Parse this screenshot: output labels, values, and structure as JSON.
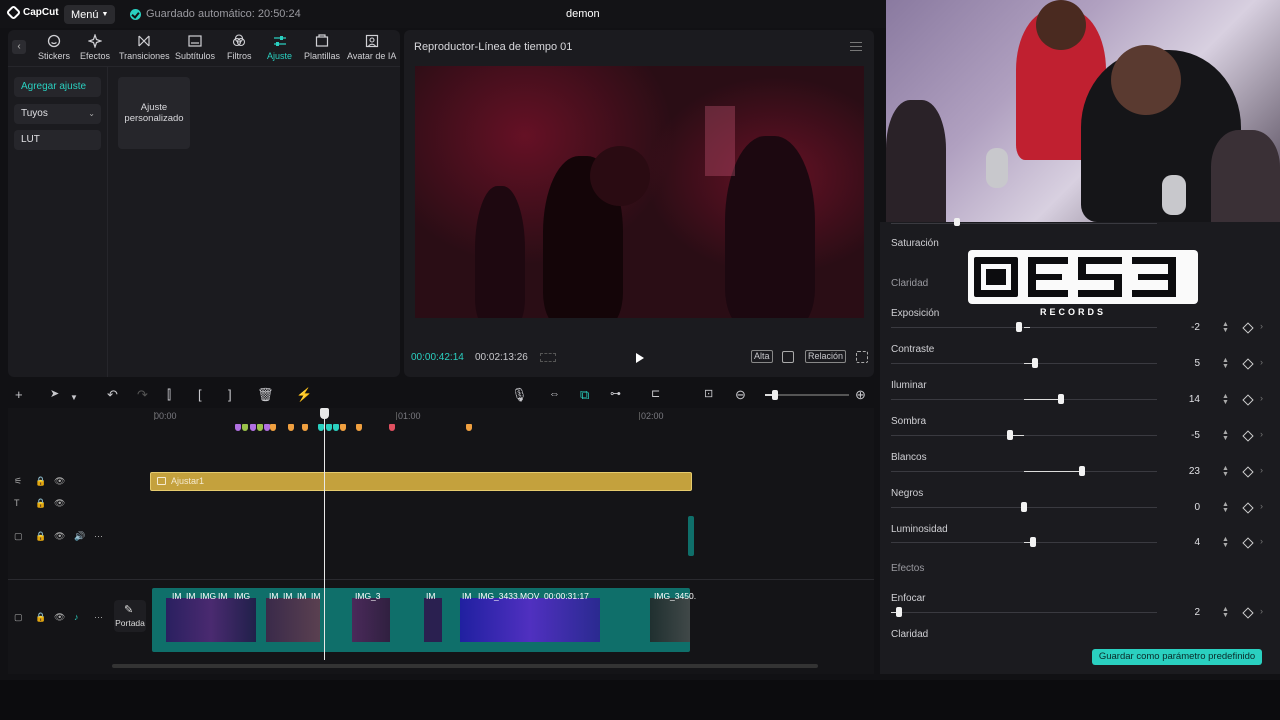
{
  "topbar": {
    "logo_text": "CapCut",
    "menu_label": "Menú",
    "autosave_text": "Guardado automático: 20:50:24",
    "project_title": "demon"
  },
  "tools": [
    {
      "label": "Stickers",
      "icon": "sticker-icon"
    },
    {
      "label": "Efectos",
      "icon": "effects-icon"
    },
    {
      "label": "Transiciones",
      "icon": "transitions-icon"
    },
    {
      "label": "Subtítulos",
      "icon": "subtitles-icon"
    },
    {
      "label": "Filtros",
      "icon": "filters-icon"
    },
    {
      "label": "Ajuste",
      "icon": "adjust-icon",
      "active": true
    },
    {
      "label": "Plantillas",
      "icon": "templates-icon"
    },
    {
      "label": "Avatar de IA",
      "icon": "ai-avatar-icon"
    }
  ],
  "sidebar": {
    "items": [
      {
        "label": "Agregar ajuste",
        "active": true
      },
      {
        "label": "Tuyos"
      },
      {
        "label": "LUT"
      }
    ],
    "preset_card": "Ajuste personalizado"
  },
  "player": {
    "title": "Reproductor-Línea de tiempo 01",
    "current_time": "00:00:42:14",
    "total_time": "00:02:13:26",
    "quality_label": "Alta",
    "ratio_label": "Relación"
  },
  "timeline": {
    "ruler": [
      "00:00",
      "01:00",
      "02:00"
    ],
    "adjust_clip_label": "Ajustar1",
    "cover_label": "Portada",
    "clip_labels": [
      "IM",
      "IM",
      "IMG",
      "IM",
      "IMG",
      "IM",
      "IM",
      "IM",
      "IM",
      "IMG_3",
      "IM",
      "IM",
      "IMG_3433.MOV",
      "00:00:31:17",
      "IMG_3450."
    ]
  },
  "adjust_panel": {
    "sections": {
      "saturacion": "Saturación",
      "claridad_section": "Claridad",
      "efectos_section": "Efectos"
    },
    "sliders": [
      {
        "label": "Exposición",
        "value": "-2"
      },
      {
        "label": "Contraste",
        "value": "5"
      },
      {
        "label": "Iluminar",
        "value": "14"
      },
      {
        "label": "Sombra",
        "value": "-5"
      },
      {
        "label": "Blancos",
        "value": "23"
      },
      {
        "label": "Negros",
        "value": "0"
      },
      {
        "label": "Luminosidad",
        "value": "4"
      },
      {
        "label": "Enfocar",
        "value": "2"
      }
    ],
    "last_label": "Claridad",
    "save_preset_label": "Guardar como parámetro predefinido"
  },
  "overlay_logo": {
    "text": "OES3",
    "subtitle": "RECORDS"
  },
  "colors": {
    "accent": "#2ad0c0",
    "adjust_clip": "#c4a13d",
    "main_track": "#0f6f6a"
  }
}
